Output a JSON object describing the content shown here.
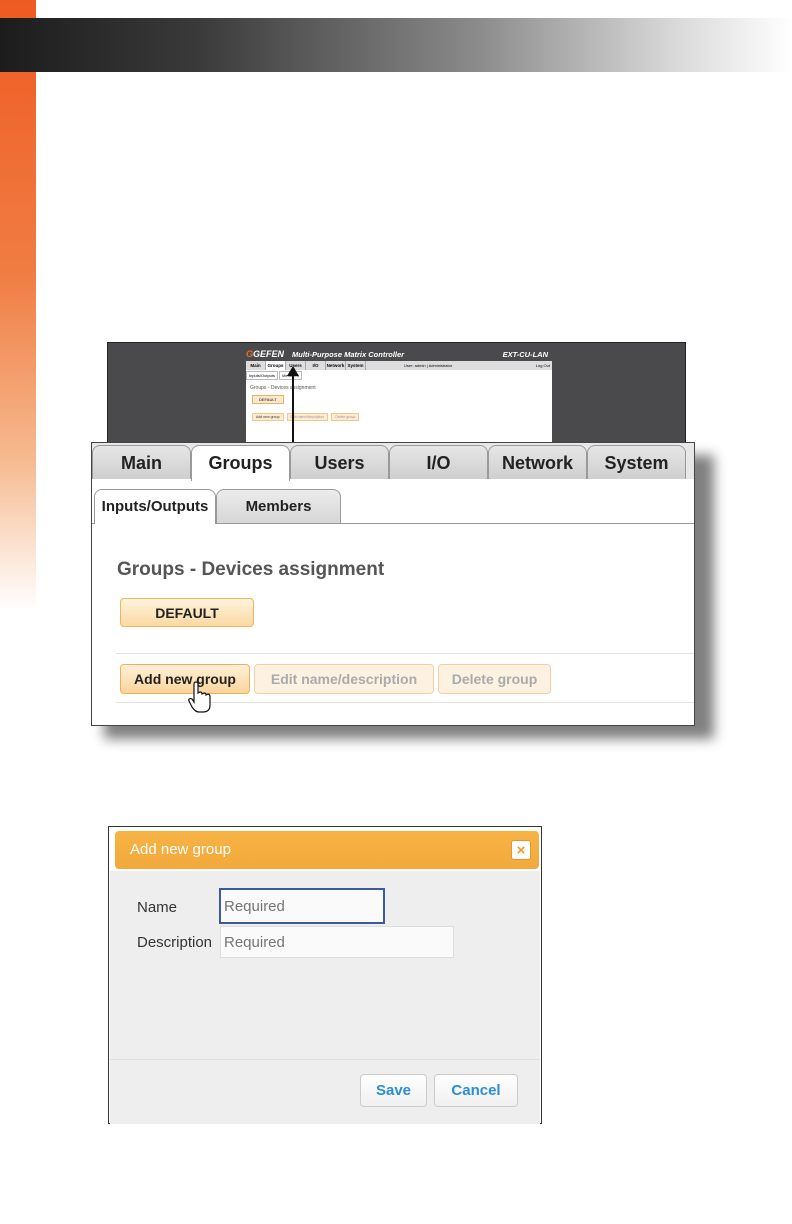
{
  "thumbnail": {
    "logo": "GEFEN",
    "app_title": "Multi-Purpose Matrix Controller",
    "model": "EXT-CU-LAN",
    "tabs": [
      "Main",
      "Groups",
      "Users",
      "I/O",
      "Network",
      "System"
    ],
    "user_info": "User: admin  |  Administrator",
    "logout": "Log Out",
    "subtabs": [
      "Inputs/Outputs",
      "Members"
    ],
    "heading": "Groups - Devices assignment",
    "default_group": "DEFAULT",
    "buttons": [
      "Add new group",
      "Edit name/description",
      "Delete group"
    ]
  },
  "zoom": {
    "tabs": {
      "main": "Main",
      "groups": "Groups",
      "users": "Users",
      "io": "I/O",
      "network": "Network",
      "system": "System"
    },
    "subtabs": {
      "inputs_outputs": "Inputs/Outputs",
      "members": "Members"
    },
    "heading": "Groups - Devices assignment",
    "default_group": "DEFAULT",
    "buttons": {
      "add": "Add new group",
      "edit": "Edit name/description",
      "delete": "Delete group"
    }
  },
  "dialog": {
    "title": "Add new group",
    "close": "×",
    "name_label": "Name",
    "name_placeholder": "Required",
    "description_label": "Description",
    "description_placeholder": "Required",
    "save": "Save",
    "cancel": "Cancel"
  },
  "colors": {
    "accent_orange": "#f2a83c",
    "page_side_bar": "#ee5a22",
    "button_text_blue": "#2a8ed8"
  }
}
